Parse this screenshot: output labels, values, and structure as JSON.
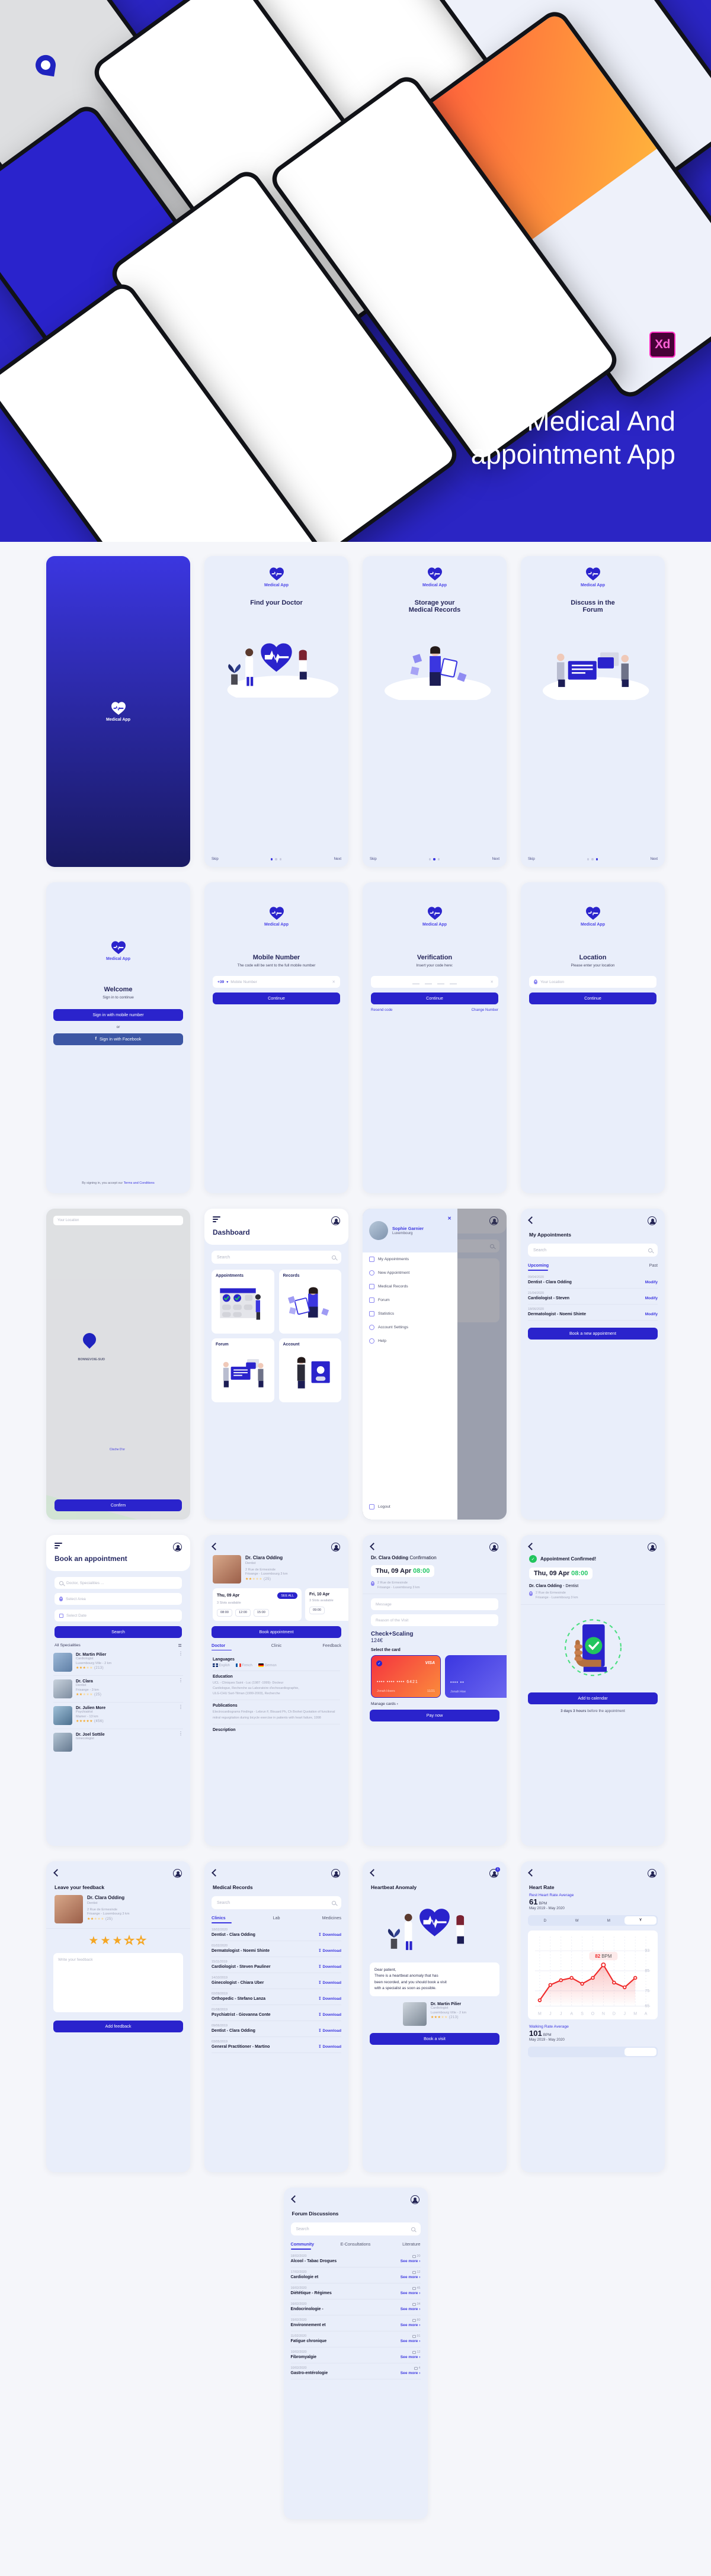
{
  "hero": {
    "title_line1": "Medical And",
    "title_line2": "appointment App",
    "xd_badge": "Xd",
    "map_label": "BONNEVOIE-SUD"
  },
  "brand": {
    "name": "Medical App",
    "accent": "#2a23cc",
    "bg": "#e9eefa",
    "green": "#22c55e",
    "star": "#f5a623",
    "red": "#f5333f"
  },
  "splash": {
    "name": "Medical App"
  },
  "onboarding": [
    {
      "brand": "Medical App",
      "title": "Find your Doctor",
      "skip": "Skip",
      "next": "Next",
      "dot_index": 0
    },
    {
      "brand": "Medical App",
      "title_line1": "Storage your",
      "title_line2": "Medical Records",
      "skip": "Skip",
      "next": "Next",
      "dot_index": 1
    },
    {
      "brand": "Medical App",
      "title_line1": "Discuss in the",
      "title_line2": "Forum",
      "skip": "Skip",
      "next": "Next",
      "dot_index": 2
    }
  ],
  "welcome": {
    "brand": "Medical App",
    "title": "Welcome",
    "subtitle": "Sign in to continue",
    "mobile_btn": "Sign in with mobile number",
    "or": "or",
    "facebook_btn": "Sign in with Facebook",
    "terms_prefix": "By signing in, you accept our ",
    "terms_link": "Terms and Conditions"
  },
  "mobile_number": {
    "brand": "Medical App",
    "title": "Mobile Number",
    "subtitle": "The code will be sent to the full mobile number",
    "country_code": "+39",
    "placeholder": "Mobile Number",
    "continue_btn": "Continue"
  },
  "verification": {
    "brand": "Medical App",
    "title": "Verification",
    "subtitle": "Insert your code here:",
    "continue_btn": "Continue",
    "resend": "Resend code",
    "change": "Change Number"
  },
  "location": {
    "brand": "Medical App",
    "title": "Location",
    "subtitle": "Please enter your location",
    "placeholder": "Your Location",
    "continue_btn": "Continue"
  },
  "map_screen": {
    "search_placeholder": "Your Location",
    "area_label": "BONNEVOIE-SUD",
    "poi_label": "Cloche D'or",
    "confirm_btn": "Confirm"
  },
  "dashboard": {
    "title": "Dashboard",
    "search_placeholder": "Search",
    "cards": [
      {
        "label": "Appointments"
      },
      {
        "label": "Records"
      },
      {
        "label": "Forum"
      },
      {
        "label": "Account"
      }
    ]
  },
  "drawer": {
    "user_name": "Sophie Garnier",
    "user_location": "Luxembourg",
    "close": "✕",
    "items": [
      {
        "label": "My Appointments",
        "icon": "calendar-icon"
      },
      {
        "label": "New Appointment",
        "icon": "plus-circle-icon"
      },
      {
        "label": "Medical Records",
        "icon": "file-icon"
      },
      {
        "label": "Forum",
        "icon": "chat-icon"
      },
      {
        "label": "Statistics",
        "icon": "chart-icon"
      },
      {
        "label": "Account Settings",
        "icon": "gear-icon"
      },
      {
        "label": "Help",
        "icon": "info-icon"
      }
    ],
    "logout": "Logout"
  },
  "my_appointments": {
    "title": "My Appointments",
    "search_placeholder": "Search",
    "tabs": [
      "Upcoming",
      "Past"
    ],
    "active_tab": "Upcoming",
    "rows": [
      {
        "date": "09/04/2020",
        "title": "Dentist - Clara Odding",
        "action": "Modify"
      },
      {
        "date": "21/04/2020",
        "title": "Cardiologist - Steven",
        "action": "Modify"
      },
      {
        "date": "18/06/2020",
        "title": "Dermatologist - Noemi Shinte",
        "action": "Modify"
      }
    ],
    "cta": "Book a new appointment"
  },
  "book_appointment": {
    "title": "Book an appointment",
    "search_placeholder": "Doctor, Specialities ...",
    "area_placeholder": "Select Area",
    "date_placeholder": "Select Date",
    "search_btn": "Search",
    "list_header": "All Specialities",
    "doctors": [
      {
        "name": "Dr. Martin Pilier",
        "spec": "Cardiologist",
        "loc": "Luxembourg Ville - 2 km",
        "rating": 3,
        "reviews": "(213)"
      },
      {
        "name": "Dr. Clara",
        "spec": "Dentist",
        "loc": "Frisange - 3 km",
        "rating": 2,
        "reviews": "(25)"
      },
      {
        "name": "Dr. Julien More",
        "spec": "Psychiatrist",
        "loc": "Mamer - 13 km",
        "rating": 5,
        "reviews": "(456)"
      },
      {
        "name": "Dr. Joel Sottile",
        "spec": "Ginecologist",
        "loc": "Luxembourg Ville - 2 km",
        "rating": 4,
        "reviews": "(98)"
      }
    ]
  },
  "doctor_profile": {
    "name": "Dr. Clara Odding",
    "spec": "Dentist",
    "address_line1": "2 Rue de Ermesinde",
    "address_line2": "Frisange - Luxembourg 3 km",
    "rating": 2,
    "reviews": "(25)",
    "days": [
      {
        "label": "Thu, 09 Apr",
        "slots_text": "3 Slots available",
        "see_all": "SEE ALL",
        "slots": [
          "08:00",
          "12:00",
          "15:00"
        ]
      },
      {
        "label": "Fri, 10 Apr",
        "slots_text": "3 Slots available",
        "slots": [
          "09:00"
        ]
      }
    ],
    "book_btn": "Book appointment",
    "tabs": [
      "Doctor",
      "Clinic",
      "Feedback"
    ],
    "active_tab": "Doctor",
    "languages_header": "Languages",
    "languages": [
      "English",
      "French",
      "German"
    ],
    "education_header": "Education",
    "education": [
      "UCL - Cliniques Saint - Luc (1987 -1999)- Docteur",
      "Cardiologue, Recherche au Laboratoire d'echocardiographie,",
      "ULG-CHU Sart-Tilman (1999-2003), Recherche"
    ],
    "publications_header": "Publications",
    "publications": [
      "Electrocardiograms Findings - Lebrun F, Blouard Ph, Ch Brohet Quotation of functional mitral regurgitation during bicycle exercise in patients with heart failure, 1998"
    ],
    "description_header": "Description"
  },
  "confirmation": {
    "title_bold": "Dr. Clara Odding",
    "title_rest": " Confirmation",
    "date": "Thu, 09 Apr",
    "time": "08:00",
    "address_line1": "2 Rue de Ermesinde",
    "address_line2": "Frisange - Luxembourg 3 km",
    "message_placeholder": "Message",
    "reason_placeholder": "Reason of the Visit",
    "service": "Check+Scaling",
    "price": "124€",
    "select_card": "Select the card",
    "cards": [
      {
        "brand": "VISA",
        "digits": "••••  ••••  ••••  6421",
        "name": "Jonah Hoers",
        "exp": "11/21",
        "selected": true
      },
      {
        "brand": "",
        "digits": "••••  ••",
        "name": "Jonah Hoe",
        "exp": "",
        "selected": false
      }
    ],
    "manage_cards": "Manage cards",
    "pay_btn": "Pay now"
  },
  "confirmed": {
    "badge": "Appointment Confirmed!",
    "date": "Thu, 09 Apr",
    "time": "08:00",
    "doctor_bold": "Dr. Clara Odding",
    "doctor_rest": " - Dentist",
    "address_line1": "2 Rue de Ermesinde",
    "address_line2": "Frisange - Luxembourg 3 km",
    "cta": "Add to calendar",
    "reminder_bold": "3 days 3 hours",
    "reminder_rest": " before the appointment"
  },
  "feedback": {
    "title": "Leave your feedback",
    "doctor": "Dr. Clara Odding",
    "spec": "Dentist",
    "address_line1": "2 Rue de Ermesinde",
    "address_line2": "Frisange - Luxembourg 3 km",
    "reviews": "(25)",
    "card_rating": 2,
    "rating": 3,
    "placeholder": "Write your feedback",
    "cta": "Add feedback"
  },
  "medical_records": {
    "title": "Medical Records",
    "search_placeholder": "Search",
    "tabs": [
      "Clinics",
      "Lab",
      "Medicines"
    ],
    "active_tab": "Clinics",
    "rows": [
      {
        "date": "18/02/2020",
        "title": "Dentist - Clara Odding",
        "action": "Download"
      },
      {
        "date": "01/02/2020",
        "title": "Dermatologist - Noemi Shinte",
        "action": "Download"
      },
      {
        "date": "15/11/2019",
        "title": "Cardiologist - Steven Pauliner",
        "action": "Download"
      },
      {
        "date": "14/10/2019",
        "title": "Ginecologist - Chiara Uber",
        "action": "Download"
      },
      {
        "date": "02/09/2019",
        "title": "Orthopedic - Stefano Lanza",
        "action": "Download"
      },
      {
        "date": "01/08/2019",
        "title": "Psychiatrist - Giovanna Conte",
        "action": "Download"
      },
      {
        "date": "09/06/2019",
        "title": "Dentist - Clara Odding",
        "action": "Download"
      },
      {
        "date": "03/05/2019",
        "title": "General Practitioner - Martino",
        "action": "Download"
      }
    ]
  },
  "heartbeat": {
    "title": "Heartbeat Anomaly",
    "notification_count": "1",
    "message_line1": "Dear patient,",
    "message_line2": "There is a heartbeat anomaly that has",
    "message_line3": "been recorded, and you should book a visit",
    "message_line4": "with a specialist as soon as possible.",
    "doctor": {
      "name": "Dr. Martin Pilier",
      "spec": "Cardiologist",
      "loc": "Luxembourg Ville - 2 km",
      "rating": 3,
      "reviews": "(213)"
    },
    "cta": "Book a visit"
  },
  "heart_rate": {
    "title": "Heart Rate",
    "rest_label": "Rest Heart Rate Average",
    "rest_value": "61",
    "rest_unit": "BPM",
    "rest_period": "May 2019 - May 2020",
    "segments": [
      "D",
      "W",
      "M",
      "Y"
    ],
    "active_segment": "Y",
    "tooltip": {
      "value": "82",
      "unit": "BPM"
    },
    "walking_label": "Walking Rate Average",
    "walking_value": "101",
    "walking_unit": "BPM",
    "walking_period": "May 2019 - May 2020"
  },
  "chart_data": {
    "type": "line",
    "title": "Rest Heart Rate Average",
    "xlabel": "",
    "ylabel": "BPM",
    "x": [
      "M",
      "J",
      "J",
      "A",
      "S",
      "O",
      "N",
      "D",
      "J",
      "M",
      "A"
    ],
    "values": [
      62,
      73,
      76,
      77,
      74,
      77,
      82,
      74,
      72,
      77,
      null
    ],
    "annotation": {
      "x": "N",
      "y": 82,
      "text": "82 BPM"
    },
    "ylim": [
      58,
      94
    ],
    "yticks": [
      65,
      75,
      85,
      93
    ],
    "ytick_labels": [
      "65",
      "75",
      "85",
      "93"
    ],
    "grid": true,
    "legend": false,
    "series_color": "#ef2b2b",
    "fill": true
  },
  "forum": {
    "title": "Forum Discussions",
    "search_placeholder": "Search",
    "tabs": [
      "Community",
      "E-Consultations",
      "Literature"
    ],
    "active_tab": "Community",
    "action": "See more",
    "rows": [
      {
        "date": "18/02/2020",
        "title": "Alcool - Tabac Drogues",
        "comments": "20"
      },
      {
        "date": "17/02/2020",
        "title": "Cardiologie et",
        "comments": "12"
      },
      {
        "date": "16/02/2020",
        "title": "Diététique - Régimes",
        "comments": "45"
      },
      {
        "date": "16/02/2020",
        "title": "Endocrinologie -",
        "comments": "34"
      },
      {
        "date": "15/02/2020",
        "title": "Environnement et",
        "comments": "80"
      },
      {
        "date": "11/02/2020",
        "title": "Fatigue chronique",
        "comments": "91"
      },
      {
        "date": "10/02/2020",
        "title": "Fibromyalgie",
        "comments": "12"
      },
      {
        "date": "10/02/2020",
        "title": "Gastro-entérologie",
        "comments": "4"
      }
    ]
  }
}
